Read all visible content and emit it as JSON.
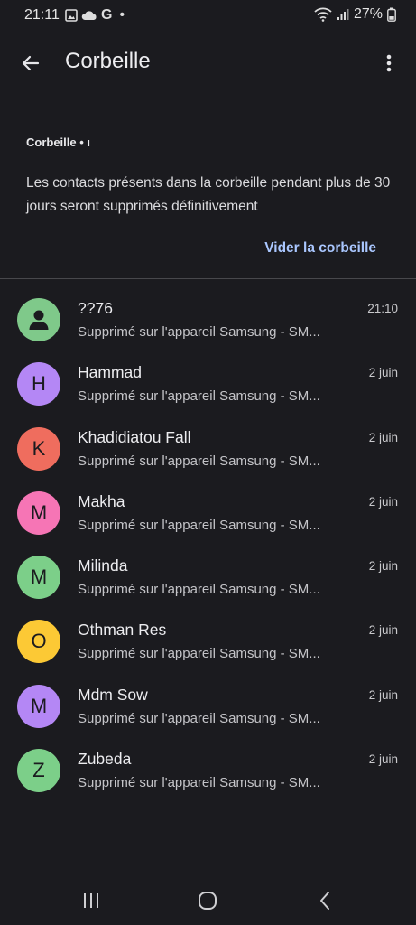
{
  "status_bar": {
    "time": "21:11",
    "battery": "27%",
    "carrier_letter": "G"
  },
  "app_bar": {
    "title": "Corbeille"
  },
  "info": {
    "label": "Corbeille • ı",
    "description": "Les contacts présents dans la corbeille pendant plus de 30 jours seront supprimés définitivement",
    "action": "Vider la corbeille"
  },
  "contacts": [
    {
      "name": "??76",
      "initial": "",
      "color": "#7fc98a",
      "date": "21:10",
      "subtitle": "Supprimé sur l'appareil Samsung - SM..."
    },
    {
      "name": "Hammad",
      "initial": "H",
      "color": "#b487f5",
      "date": "2 juin",
      "subtitle": "Supprimé sur l'appareil Samsung - SM..."
    },
    {
      "name": "Khadidiatou Fall",
      "initial": "K",
      "color": "#ef6d5e",
      "date": "2 juin",
      "subtitle": "Supprimé sur l'appareil Samsung - SM..."
    },
    {
      "name": "Makha",
      "initial": "M",
      "color": "#f675b5",
      "date": "2 juin",
      "subtitle": "Supprimé sur l'appareil Samsung - SM..."
    },
    {
      "name": "Milinda",
      "initial": "M",
      "color": "#7ccf89",
      "date": "2 juin",
      "subtitle": "Supprimé sur l'appareil Samsung - SM..."
    },
    {
      "name": "Othman Res",
      "initial": "O",
      "color": "#fcc935",
      "date": "2 juin",
      "subtitle": "Supprimé sur l'appareil Samsung - SM..."
    },
    {
      "name": "Mdm Sow",
      "initial": "M",
      "color": "#b487f5",
      "date": "2 juin",
      "subtitle": "Supprimé sur l'appareil Samsung - SM..."
    },
    {
      "name": "Zubeda",
      "initial": "Z",
      "color": "#7ccf89",
      "date": "2 juin",
      "subtitle": "Supprimé sur l'appareil Samsung - SM..."
    }
  ],
  "icons": {
    "back": "arrow-back-icon",
    "more": "more-vert-icon",
    "nav_recents": "recents-icon",
    "nav_home": "home-icon",
    "nav_back": "nav-back-icon"
  }
}
